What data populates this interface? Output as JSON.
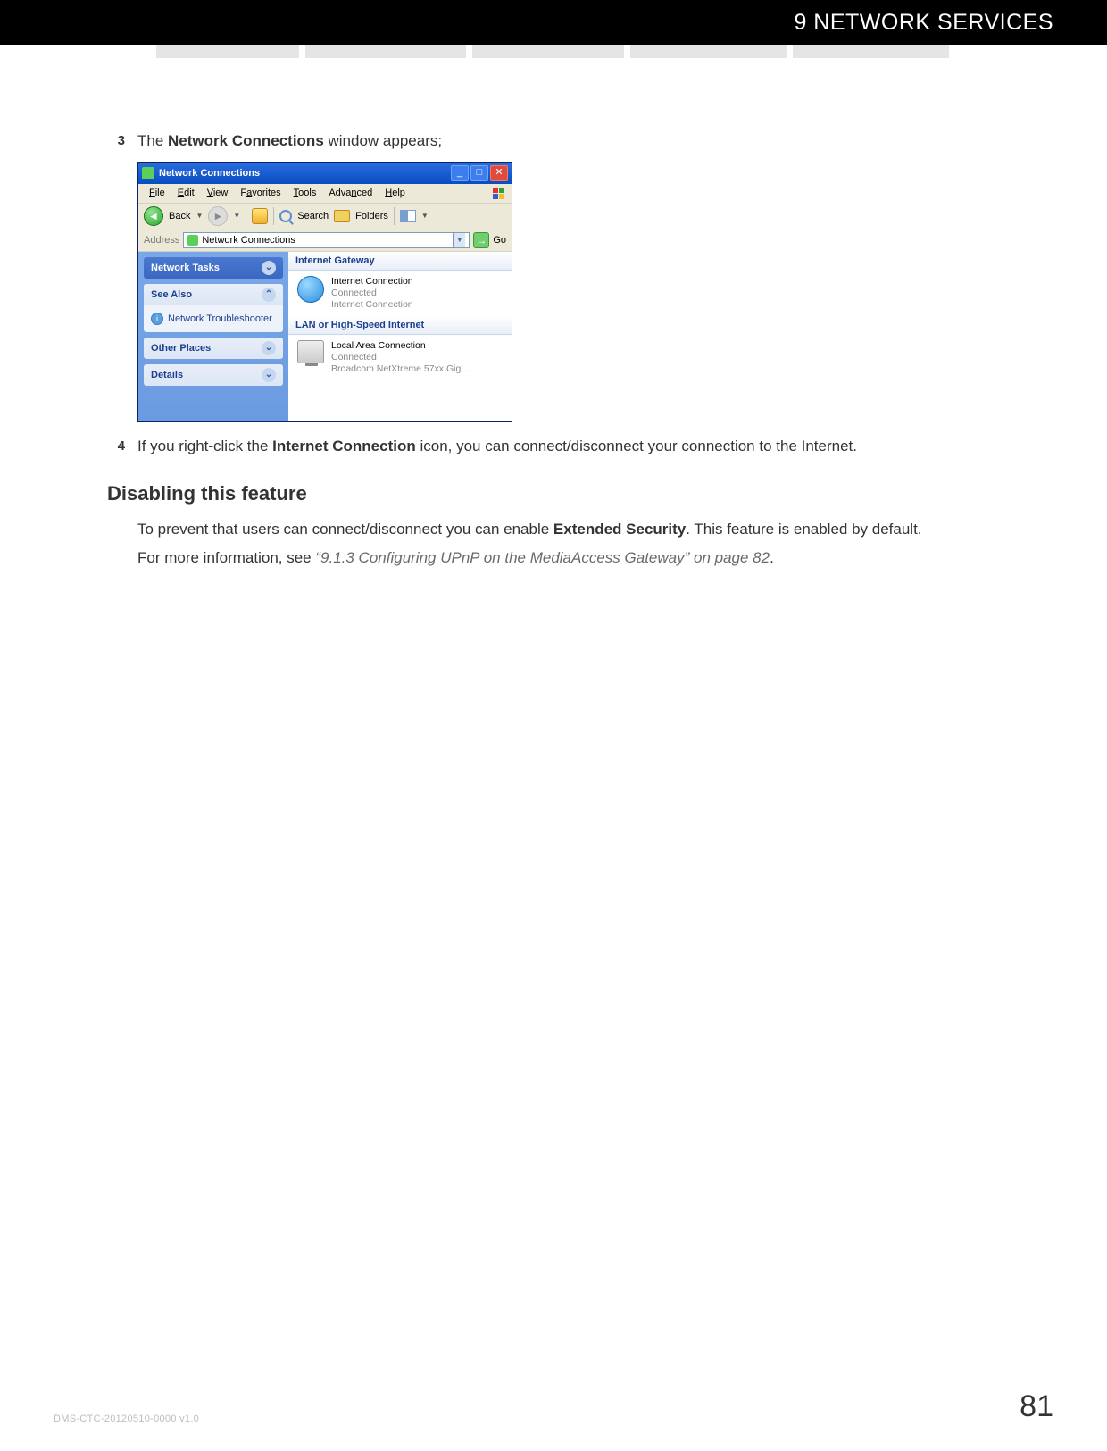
{
  "header": {
    "title": "9 NETWORK SERVICES"
  },
  "tabs": {
    "widths": [
      160,
      180,
      170,
      175,
      175
    ]
  },
  "steps": {
    "s3": {
      "num": "3",
      "pre": "The ",
      "bold": "Network Connections",
      "post": " window appears;"
    },
    "s4": {
      "num": "4",
      "pre": "If you right-click the ",
      "bold": "Internet Connection",
      "post": " icon, you can connect/disconnect your connection to the Internet."
    }
  },
  "screenshot": {
    "title": "Network Connections",
    "menus": {
      "file": "File",
      "edit": "Edit",
      "view": "View",
      "favorites": "Favorites",
      "tools": "Tools",
      "advanced": "Advanced",
      "help": "Help"
    },
    "toolbar": {
      "back": "Back",
      "search": "Search",
      "folders": "Folders"
    },
    "address": {
      "label": "Address",
      "value": "Network Connections",
      "go": "Go"
    },
    "sidebar": {
      "tasks_head": "Network Tasks",
      "seealso_head": "See Also",
      "seealso_link": "Network Troubleshooter",
      "other_head": "Other Places",
      "details_head": "Details"
    },
    "main": {
      "cat1": "Internet Gateway",
      "item1_title": "Internet Connection",
      "item1_status": "Connected",
      "item1_via": "Internet Connection",
      "cat2": "LAN or High-Speed Internet",
      "item2_title": "Local Area Connection",
      "item2_status": "Connected",
      "item2_via": "Broadcom NetXtreme 57xx Gig..."
    }
  },
  "subheading": "Disabling this feature",
  "para1": {
    "pre": "To prevent that users can connect/disconnect you can enable ",
    "bold": "Extended Security",
    "post": ". This feature is enabled by default."
  },
  "para2": {
    "pre": "For more information, see ",
    "ref": "“9.1.3 Configuring UPnP on the MediaAccess Gateway” on page 82",
    "post": "."
  },
  "footer": {
    "doc_id": "DMS-CTC-20120510-0000 v1.0",
    "page": "81"
  }
}
